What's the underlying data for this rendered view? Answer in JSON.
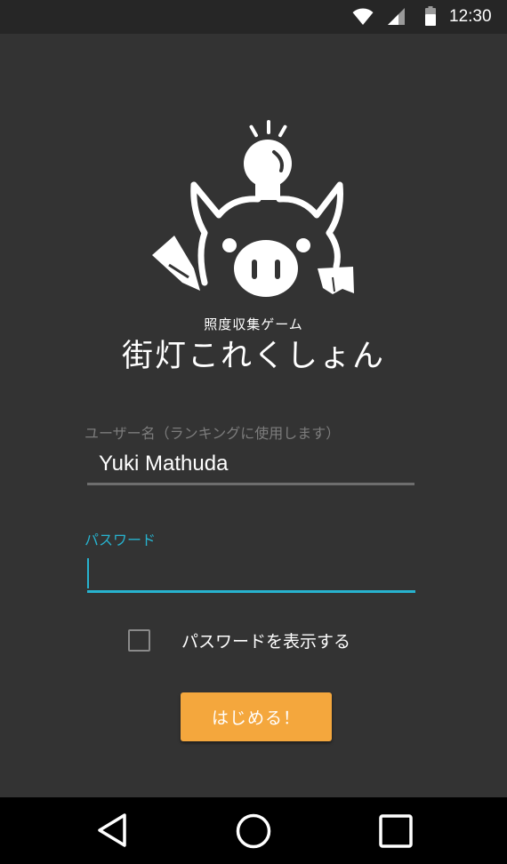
{
  "status_bar": {
    "time": "12:30",
    "icons": [
      "wifi-icon",
      "cell-signal-icon",
      "battery-icon"
    ]
  },
  "logo": {
    "icon": "boar-lightbulb-logo"
  },
  "header": {
    "subtitle": "照度収集ゲーム",
    "title": "街灯これくしょん"
  },
  "form": {
    "username_label": "ユーザー名（ランキングに使用します）",
    "username_value": "Yuki Mathuda",
    "password_label": "パスワード",
    "password_value": "",
    "show_password_label": "パスワードを表示する",
    "show_password_checked": false,
    "start_button": "はじめる！"
  },
  "nav_bar": {
    "icons": [
      "back-icon",
      "home-icon",
      "recents-icon"
    ]
  },
  "colors": {
    "background": "#333333",
    "accent": "#27b3cf",
    "button": "#f4a73d",
    "status_bar": "#262626",
    "nav_bar": "#000000"
  }
}
